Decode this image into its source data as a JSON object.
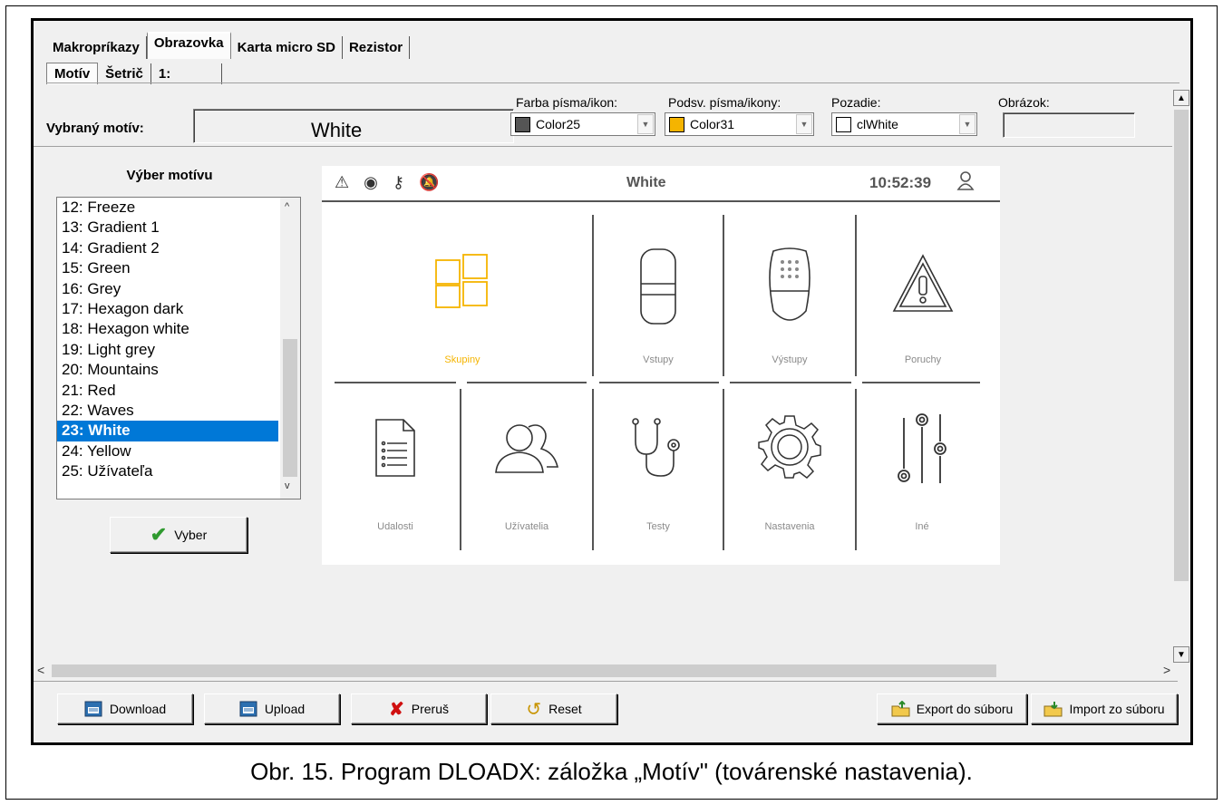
{
  "tabs_main": [
    {
      "label": "Makropríkazy",
      "active": false
    },
    {
      "label": "Obrazovka",
      "active": true
    },
    {
      "label": "Karta micro SD",
      "active": false
    },
    {
      "label": "Rezistor",
      "active": false
    }
  ],
  "tabs_sub": [
    {
      "label": "Motív",
      "active": true
    },
    {
      "label": "Šetrič",
      "active": false
    },
    {
      "label": "1:",
      "active": false
    }
  ],
  "theme_bar": {
    "selected_label": "Vybraný motív:",
    "selected_value": "White",
    "font_color_label": "Farba písma/ikon:",
    "font_color_value": "Color25",
    "font_color_swatch": "#555555",
    "backlight_label": "Podsv. písma/ikony:",
    "backlight_value": "Color31",
    "backlight_swatch": "#f5b400",
    "background_label": "Pozadie:",
    "background_value": "clWhite",
    "background_swatch": "#ffffff",
    "image_label": "Obrázok:",
    "image_value": ""
  },
  "theme_list": {
    "title": "Výber motívu",
    "items": [
      "12: Freeze",
      "13: Gradient 1",
      "14: Gradient 2",
      "15: Green",
      "16: Grey",
      "17: Hexagon dark",
      "18: Hexagon white",
      "19: Light grey",
      "20: Mountains",
      "21: Red",
      "22: Waves",
      "23: White",
      "24: Yellow",
      "25: Užívateľa"
    ],
    "selected": "23: White",
    "select_button": "Vyber"
  },
  "preview": {
    "title": "White",
    "time": "10:52:39",
    "status_icons": [
      "alarm-triangle-icon",
      "eye-icon",
      "key-icon",
      "bell-off-icon"
    ],
    "tiles": [
      {
        "label": "Skupiny",
        "icon": "partitions-icon",
        "highlight": true
      },
      {
        "label": "Vstupy",
        "icon": "detector-icon",
        "highlight": false
      },
      {
        "label": "Výstupy",
        "icon": "siren-icon",
        "highlight": false
      },
      {
        "label": "Poruchy",
        "icon": "warning-icon",
        "highlight": false
      },
      {
        "label": "Udalosti",
        "icon": "document-icon",
        "highlight": false
      },
      {
        "label": "Užívatelia",
        "icon": "users-icon",
        "highlight": false
      },
      {
        "label": "Testy",
        "icon": "stethoscope-icon",
        "highlight": false
      },
      {
        "label": "Nastavenia",
        "icon": "gear-icon",
        "highlight": false
      },
      {
        "label": "Iné",
        "icon": "sliders-icon",
        "highlight": false
      }
    ],
    "accent_color": "#f5b400"
  },
  "buttons": {
    "download": "Download",
    "upload": "Upload",
    "abort": "Preruš",
    "reset": "Reset",
    "export": "Export do súboru",
    "import": "Import zo súboru"
  },
  "caption": "Obr. 15. Program DLOADX: záložka „Motív\" (továrenské nastavenia)."
}
